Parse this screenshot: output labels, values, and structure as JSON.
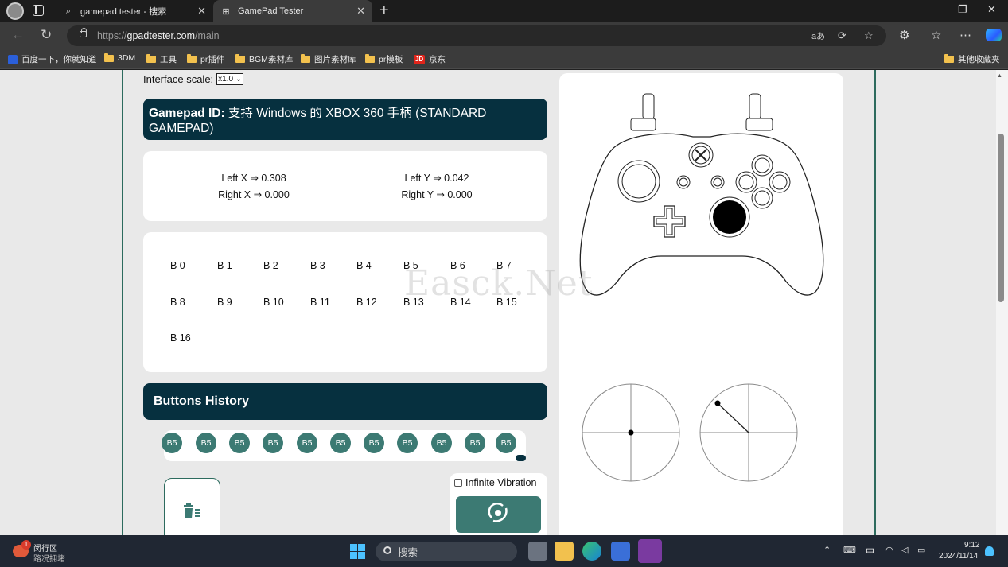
{
  "browser": {
    "tabs": [
      {
        "title": "gamepad tester - 搜索"
      },
      {
        "title": "GamePad Tester"
      }
    ],
    "url": {
      "scheme": "https://",
      "host": "gpadtester.com",
      "path": "/main"
    },
    "bookmarks": [
      {
        "label": "百度一下，你就知道",
        "icon": "baidu-icon"
      },
      {
        "label": "3DM",
        "icon": "folder-icon"
      },
      {
        "label": "工具",
        "icon": "folder-icon"
      },
      {
        "label": "pr插件",
        "icon": "folder-icon"
      },
      {
        "label": "BGM素材库",
        "icon": "folder-icon"
      },
      {
        "label": "图片素材库",
        "icon": "folder-icon"
      },
      {
        "label": "pr模板",
        "icon": "folder-icon"
      },
      {
        "label": "京东",
        "icon": "jd-icon"
      }
    ],
    "other_bookmarks": "其他收藏夹"
  },
  "page": {
    "scale_label": "Interface scale:",
    "scale_value": "x1.0",
    "gamepad_id_label": "Gamepad ID:",
    "gamepad_id_value": "支持 Windows 的 XBOX 360 手柄 (STANDARD GAMEPAD)",
    "axes": {
      "left_x": "Left X ⇒ 0.308",
      "left_y": "Left Y ⇒ 0.042",
      "right_x": "Right X ⇒ 0.000",
      "right_y": "Right Y ⇒ 0.000"
    },
    "buttons": [
      "B 0",
      "B 1",
      "B 2",
      "B 3",
      "B 4",
      "B 5",
      "B 6",
      "B 7",
      "B 8",
      "B 9",
      "B 10",
      "B 11",
      "B 12",
      "B 13",
      "B 14",
      "B 15",
      "B 16"
    ],
    "history_title": "Buttons History",
    "history": [
      "B5",
      "B5",
      "B5",
      "B5",
      "B5",
      "B5",
      "B5",
      "B5",
      "B5",
      "B5",
      "B5"
    ],
    "infinite_vibration_label": "Infinite Vibration",
    "watermark": "Easck.Net",
    "colors": {
      "banner": "#06303f",
      "accent": "#3c7a73",
      "frame": "#2d6b5e"
    }
  },
  "taskbar": {
    "weather_title": "闵行区",
    "weather_sub": "路况拥堵",
    "weather_badge": "1",
    "search_placeholder": "搜索",
    "ime": "中",
    "time": "9:12",
    "date": "2024/11/14"
  }
}
